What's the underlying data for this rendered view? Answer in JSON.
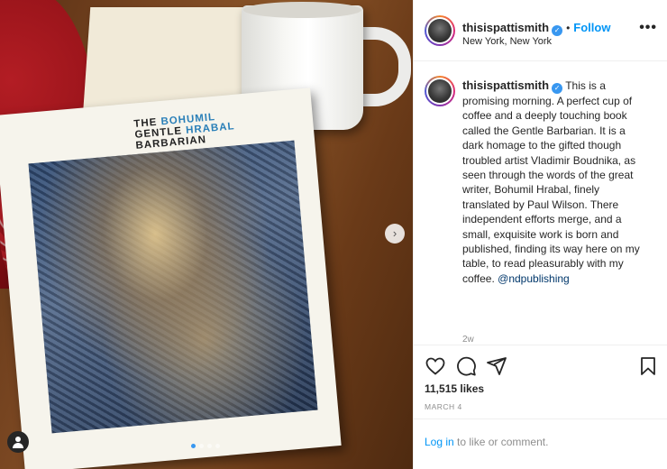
{
  "post": {
    "username": "thisispattismith",
    "verified_badge": "✓",
    "separator": "•",
    "follow_label": "Follow",
    "location": "New York, New York",
    "more_label": "•••",
    "caption_parts": [
      "This is a promising morning. A perfect cup of coffee and a deeply touching book called the Gentle Barbarian. It is a dark homage to the gifted though troubled artist Vladimir Boudnika, as seen through the words of the great writer, Bohumil Hrabal, finely translated by Paul Wilson. There independent efforts merge, and a small, exquisite work is born and published, finding its way here on my table, to read pleasurably with my coffee. "
    ],
    "mention": "@ndpublishing",
    "time_ago": "2w",
    "likes": "11,515 likes",
    "date": "MARCH 4",
    "login_link": "Log in",
    "login_rest": " to like or comment."
  },
  "photo": {
    "book_title_line1_a": "THE ",
    "book_title_line1_b": "BOHUMIL",
    "book_title_line2_a": "GENTLE ",
    "book_title_line2_b": "HRABAL",
    "book_title_line3": "BARBARIAN",
    "next_arrow": "›",
    "carousel_count": 4,
    "carousel_active": 1
  },
  "icons": {
    "like": "heart-icon",
    "comment": "comment-icon",
    "share": "share-icon",
    "save": "bookmark-icon",
    "tag": "user-tag-icon"
  },
  "colors": {
    "link_blue": "#0095f6",
    "mention": "#00376b",
    "muted": "#8e8e8e"
  }
}
